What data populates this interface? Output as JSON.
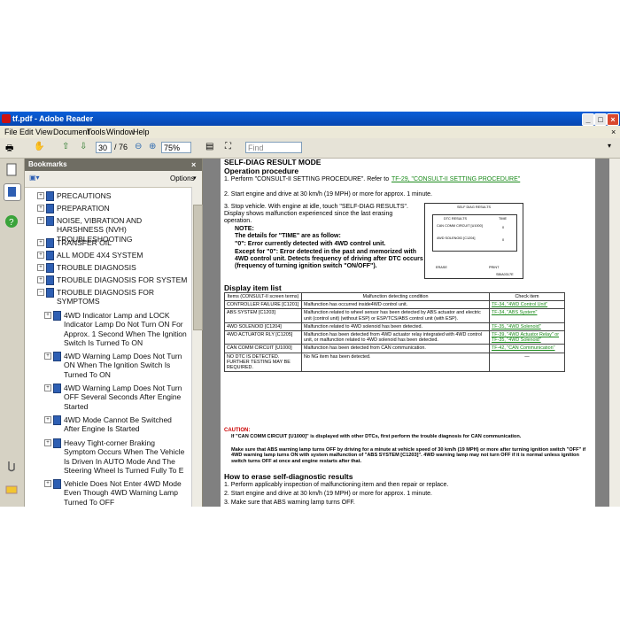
{
  "window": {
    "title": "tf.pdf - Adobe Reader"
  },
  "menu": [
    "File",
    "Edit",
    "View",
    "Document",
    "Tools",
    "Window",
    "Help"
  ],
  "toolbar": {
    "page_current": "30",
    "page_total": "/ 76",
    "zoom": "75%",
    "find_placeholder": "Find"
  },
  "bookmarks": {
    "title": "Bookmarks",
    "options": "Options",
    "items": [
      {
        "label": "PRECAUTIONS",
        "level": 0
      },
      {
        "label": "PREPARATION",
        "level": 0
      },
      {
        "label": "NOISE, VIBRATION AND HARSHNESS (NVH) TROUBLESHOOTING",
        "level": 0
      },
      {
        "label": "TRANSFER OIL",
        "level": 0
      },
      {
        "label": "ALL MODE 4X4 SYSTEM",
        "level": 0
      },
      {
        "label": "TROUBLE DIAGNOSIS",
        "level": 0
      },
      {
        "label": "TROUBLE DIAGNOSIS FOR SYSTEM",
        "level": 0
      },
      {
        "label": "TROUBLE DIAGNOSIS FOR SYMPTOMS",
        "level": 0
      },
      {
        "label": "4WD Indicator Lamp and LOCK Indicator Lamp Do Not Turn ON For Approx. 1 Second When The Ignition Switch Is Turned To ON",
        "level": 1
      },
      {
        "label": "4WD Warning Lamp Does Not Turn ON When The Ignition Switch Is Turned To ON",
        "level": 1
      },
      {
        "label": "4WD Warning Lamp Does Not Turn OFF Several Seconds After Engine Started",
        "level": 1
      },
      {
        "label": "4WD Mode Cannot Be Switched After Engine Is Started",
        "level": 1
      },
      {
        "label": "Heavy Tight-corner Braking Symptom Occurs When The Vehicle Is Driven In AUTO Mode And The Steering Wheel Is Turned Fully To E",
        "level": 1
      },
      {
        "label": "Vehicle Does Not Enter 4WD Mode Even Though 4WD Warning Lamp Turned To OFF",
        "level": 1
      }
    ]
  },
  "doc": {
    "heading": "SELF-DIAG RESULT MODE",
    "op_title": "Operation procedure",
    "step1": "1.  Perform \"CONSULT-II SETTING PROCEDURE\". Refer to",
    "step1_link": "TF-29, \"CONSULT-II SETTING PROCEDURE\"",
    "step2": "2.  Start engine and drive at 30 km/h (19 MPH) or more for approx. 1 minute.",
    "step3": "3.  Stop vehicle. With engine at idle, touch \"SELF-DIAG RESULTS\". Display shows malfunction experienced since the last erasing operation.",
    "note_label": "NOTE:",
    "note1": "The details for \"TIME\" are as follow:",
    "note2": "\"0\": Error currently detected with 4WD control unit.",
    "note3": "Except for \"0\": Error detected in the past and memorized with 4WD control unit. Detects frequency of driving after DTC occurs (frequency of turning ignition switch \"ON/OFF\").",
    "screen": {
      "title": "SELF DIAG RESULTS",
      "col1": "DTC RESULTS",
      "col2": "TIME",
      "r1": "CAN COMM CIRCUIT [U1000]",
      "r1t": "0",
      "r2": "4WD SOLENOID [C1204]",
      "r2t": "0",
      "b1": "ERASE",
      "b2": "PRINT",
      "code": "SBIA0317E"
    },
    "display_title": "Display item list",
    "table_headers": [
      "Items (CONSULT-II screen terms)",
      "Malfunction detecting condition",
      "Check item"
    ],
    "table_rows": [
      {
        "item": "CONTROLLER FAILURE [C1201]",
        "cond": "Malfunction has occurred inside4WD control unit.",
        "check": "TF-34, \"4WD Control Unit\""
      },
      {
        "item": "ABS SYSTEM [C1203]",
        "cond": "Malfunction related to wheel sensor has been detected by ABS actuator and electric unit (control unit) (without ESP) or ESP/TCS/ABS control unit (with ESP).",
        "check": "TF-34, \"ABS System\""
      },
      {
        "item": "4WD SOLENOID [C1204]",
        "cond": "Malfunction related to 4WD solenoid has been detected.",
        "check": "TF-35, \"4WD Solenoid\""
      },
      {
        "item": "4WD ACTUATOR RLY [C1205]",
        "cond": "Malfunction has been detected from 4WD actuator relay integrated with 4WD control unit, or malfunction related to 4WD solenoid has been detected.",
        "check": "TF-39, \"4WD Actuator Relay\" or TF-35, \"4WD Solenoid\""
      },
      {
        "item": "CAN COMM CIRCUIT [U1000]",
        "cond": "Malfunction has been detected from CAN communication.",
        "check": "TF-42, \"CAN Communication\""
      },
      {
        "item": "NO DTC IS DETECTED. FURTHER TESTING MAY BE REQUIRED.",
        "cond": "No NG item has been detected.",
        "check": "—"
      }
    ],
    "caution_label": "CAUTION:",
    "caution1": "If \"CAN COMM CIRCUIT [U1000]\" is displayed with other DTCs, first perform the trouble diagnosis for CAN communication.",
    "caution2": "Make sure that ABS warning lamp turns OFF by driving for a minute at vehicle speed of 30 km/h (19 MPH) or more after turning ignition switch \"OFF\" if 4WD warning lamp turns ON with system malfunction of \"ABS SYSTEM [C1203]\". 4WD warning lamp may not turn OFF if it is normal unless ignition switch turns OFF at once and engine restarts after that.",
    "erase_title": "How to erase self-diagnostic results",
    "erase1": "1.  Perform applicably inspection of malfunctioning item and then repair or replace.",
    "erase2": "2.  Start engine and drive at 30 km/h (19 MPH) or more for approx. 1 minute.",
    "erase3": "3.  Make sure that ABS warning lamp turns OFF."
  }
}
